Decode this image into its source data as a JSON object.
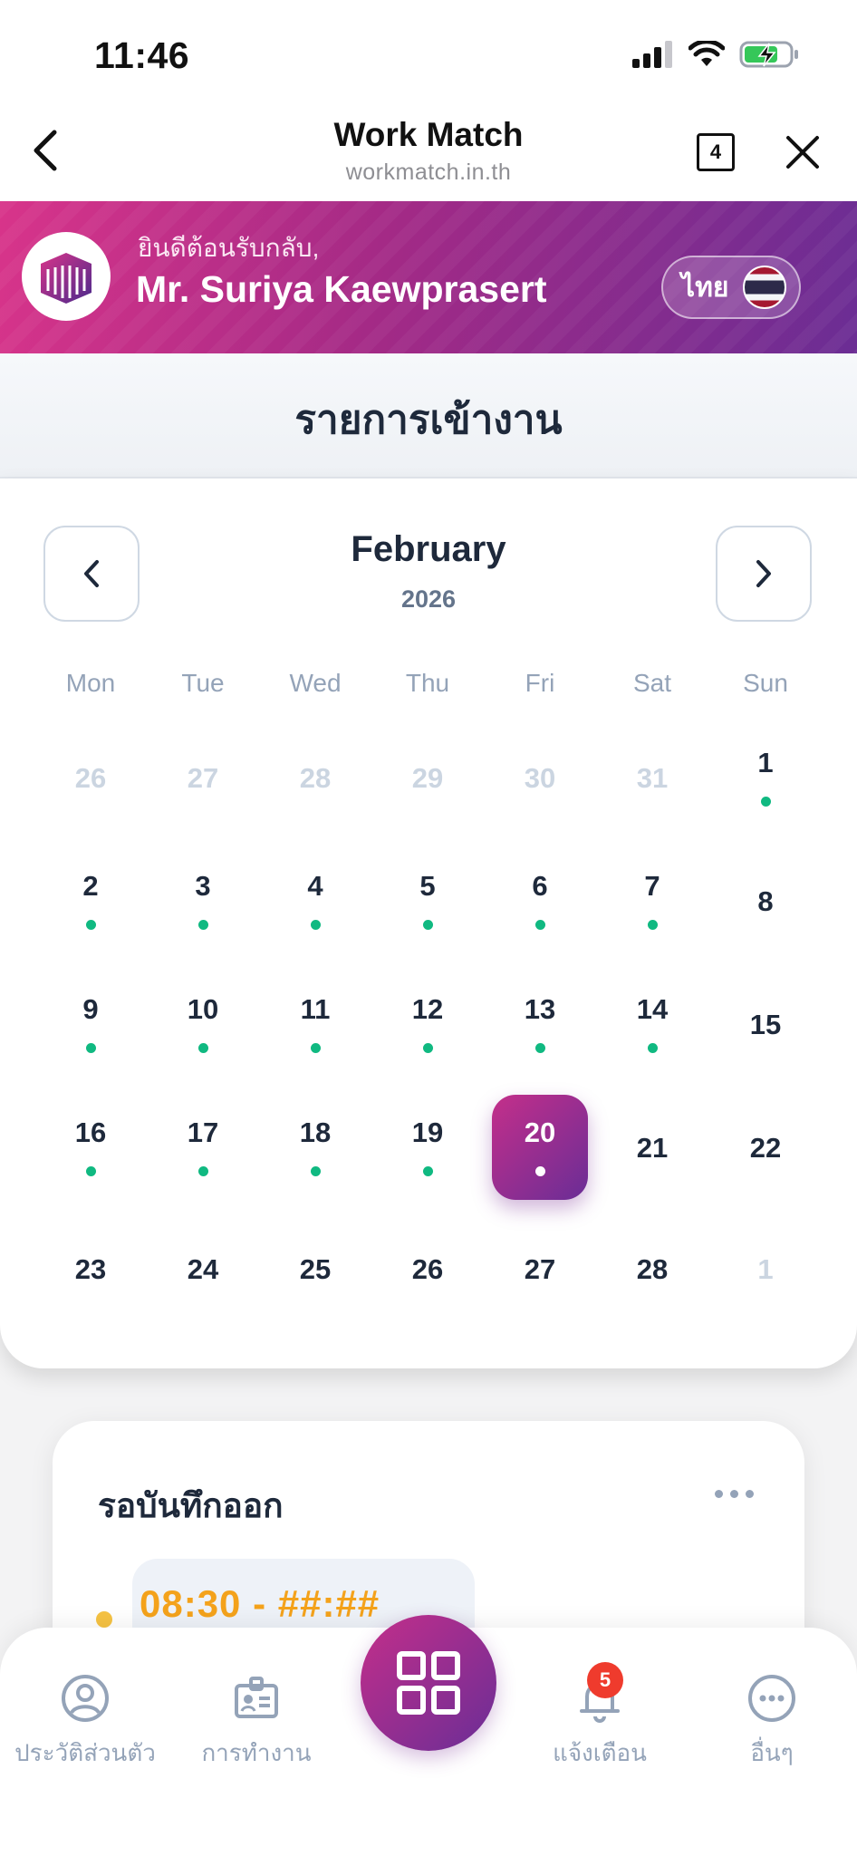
{
  "status_bar": {
    "time": "11:46"
  },
  "browser": {
    "title": "Work Match",
    "url": "workmatch.in.th",
    "tab_count": "4"
  },
  "banner": {
    "greeting": "ยินดีต้อนรับกลับ,",
    "user_name": "Mr. Suriya Kaewprasert",
    "language": "ไทย"
  },
  "page": {
    "section_title": "รายการเข้างาน"
  },
  "calendar": {
    "month": "February",
    "year": "2026",
    "weekdays": [
      "Mon",
      "Tue",
      "Wed",
      "Thu",
      "Fri",
      "Sat",
      "Sun"
    ],
    "weeks": [
      [
        {
          "d": "26",
          "muted": true,
          "dot": false
        },
        {
          "d": "27",
          "muted": true,
          "dot": false
        },
        {
          "d": "28",
          "muted": true,
          "dot": false
        },
        {
          "d": "29",
          "muted": true,
          "dot": false
        },
        {
          "d": "30",
          "muted": true,
          "dot": false
        },
        {
          "d": "31",
          "muted": true,
          "dot": false
        },
        {
          "d": "1",
          "muted": false,
          "dot": true
        }
      ],
      [
        {
          "d": "2",
          "muted": false,
          "dot": true
        },
        {
          "d": "3",
          "muted": false,
          "dot": true
        },
        {
          "d": "4",
          "muted": false,
          "dot": true
        },
        {
          "d": "5",
          "muted": false,
          "dot": true
        },
        {
          "d": "6",
          "muted": false,
          "dot": true
        },
        {
          "d": "7",
          "muted": false,
          "dot": true
        },
        {
          "d": "8",
          "muted": false,
          "dot": false
        }
      ],
      [
        {
          "d": "9",
          "muted": false,
          "dot": true
        },
        {
          "d": "10",
          "muted": false,
          "dot": true
        },
        {
          "d": "11",
          "muted": false,
          "dot": true
        },
        {
          "d": "12",
          "muted": false,
          "dot": true
        },
        {
          "d": "13",
          "muted": false,
          "dot": true
        },
        {
          "d": "14",
          "muted": false,
          "dot": true
        },
        {
          "d": "15",
          "muted": false,
          "dot": false
        }
      ],
      [
        {
          "d": "16",
          "muted": false,
          "dot": true
        },
        {
          "d": "17",
          "muted": false,
          "dot": true
        },
        {
          "d": "18",
          "muted": false,
          "dot": true
        },
        {
          "d": "19",
          "muted": false,
          "dot": true
        },
        {
          "d": "20",
          "muted": false,
          "dot": true,
          "selected": true
        },
        {
          "d": "21",
          "muted": false,
          "dot": false
        },
        {
          "d": "22",
          "muted": false,
          "dot": false
        }
      ],
      [
        {
          "d": "23",
          "muted": false,
          "dot": false
        },
        {
          "d": "24",
          "muted": false,
          "dot": false
        },
        {
          "d": "25",
          "muted": false,
          "dot": false
        },
        {
          "d": "26",
          "muted": false,
          "dot": false
        },
        {
          "d": "27",
          "muted": false,
          "dot": false
        },
        {
          "d": "28",
          "muted": false,
          "dot": false
        },
        {
          "d": "1",
          "muted": true,
          "dot": false
        }
      ]
    ]
  },
  "pending": {
    "title": "รอบันทึกออก",
    "time_range": "08:30 - ##:##"
  },
  "bottom_nav": {
    "items": [
      {
        "label": "ประวัติส่วนตัว",
        "icon": "user-circle-icon"
      },
      {
        "label": "การทำงาน",
        "icon": "id-badge-icon"
      },
      {
        "label": "",
        "icon": "grid-icon"
      },
      {
        "label": "แจ้งเตือน",
        "icon": "bell-icon"
      },
      {
        "label": "อื่นๆ",
        "icon": "more-horizontal-icon"
      }
    ],
    "notification_count": "5"
  },
  "colors": {
    "brand_gradient_start": "#d8348a",
    "brand_gradient_end": "#6b2d94",
    "attendance_dot": "#10b981",
    "pending_time": "#f4a21b",
    "badge": "#ef3b2d"
  }
}
